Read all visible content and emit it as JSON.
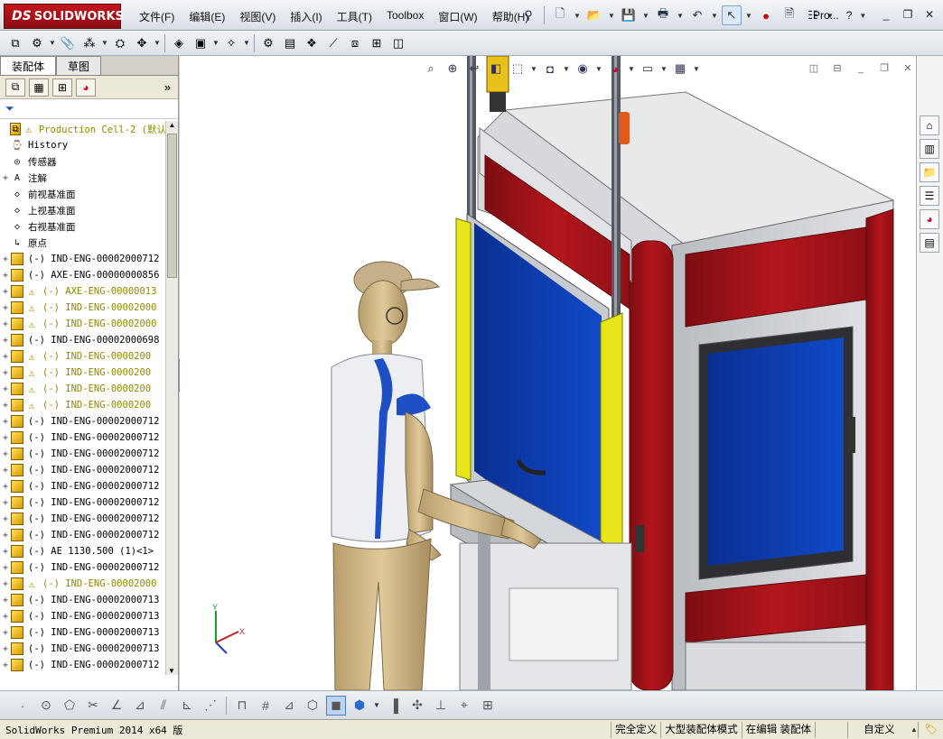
{
  "app": {
    "brand": "SOLIDWORKS",
    "brand_prefix": "DS"
  },
  "menu": [
    "文件(F)",
    "编辑(E)",
    "视图(V)",
    "插入(I)",
    "工具(T)",
    "Toolbox",
    "窗口(W)",
    "帮助(H)"
  ],
  "help_area": {
    "search_label": "Pro..."
  },
  "left_panel": {
    "tabs": [
      "装配体",
      "草图"
    ],
    "tree": [
      {
        "label": "Production Cell-2  (默认",
        "kind": "root",
        "warn": true,
        "yellow": true,
        "expander": ""
      },
      {
        "label": "History",
        "kind": "history",
        "expander": ""
      },
      {
        "label": "传感器",
        "kind": "sensor",
        "expander": ""
      },
      {
        "label": "注解",
        "kind": "annotation",
        "expander": "+"
      },
      {
        "label": "前视基准面",
        "kind": "plane",
        "expander": ""
      },
      {
        "label": "上视基准面",
        "kind": "plane",
        "expander": ""
      },
      {
        "label": "右视基准面",
        "kind": "plane",
        "expander": ""
      },
      {
        "label": "原点",
        "kind": "origin",
        "expander": ""
      },
      {
        "label": "(-) IND-ENG-00002000712",
        "kind": "asm",
        "expander": "+"
      },
      {
        "label": "(-) AXE-ENG-00000000856",
        "kind": "asm",
        "expander": "+"
      },
      {
        "label": "(-) AXE-ENG-00000013",
        "kind": "asm",
        "warn": true,
        "yellow": true,
        "expander": "+"
      },
      {
        "label": "(-) IND-ENG-00002000",
        "kind": "asm",
        "warn": true,
        "yellow": true,
        "expander": "+"
      },
      {
        "label": "(-) IND-ENG-00002000",
        "kind": "asm",
        "warn": true,
        "yellow": true,
        "expander": "+"
      },
      {
        "label": "(-) IND-ENG-00002000698",
        "kind": "asm",
        "expander": "+"
      },
      {
        "label": "(-) IND-ENG-0000200",
        "kind": "asm",
        "warn": true,
        "yellow": true,
        "expander": "+"
      },
      {
        "label": "(-) IND-ENG-0000200",
        "kind": "asm",
        "warn": true,
        "yellow": true,
        "expander": "+"
      },
      {
        "label": "(-) IND-ENG-0000200",
        "kind": "asm",
        "warn": true,
        "yellow": true,
        "expander": "+"
      },
      {
        "label": "(-) IND-ENG-0000200",
        "kind": "asm",
        "warn": true,
        "yellow": true,
        "expander": "+"
      },
      {
        "label": "(-) IND-ENG-00002000712",
        "kind": "asm",
        "expander": "+"
      },
      {
        "label": "(-) IND-ENG-00002000712",
        "kind": "asm",
        "expander": "+"
      },
      {
        "label": "(-) IND-ENG-00002000712",
        "kind": "asm",
        "expander": "+"
      },
      {
        "label": "(-) IND-ENG-00002000712",
        "kind": "asm",
        "expander": "+"
      },
      {
        "label": "(-) IND-ENG-00002000712",
        "kind": "asm",
        "expander": "+"
      },
      {
        "label": "(-) IND-ENG-00002000712",
        "kind": "asm",
        "expander": "+"
      },
      {
        "label": "(-) IND-ENG-00002000712",
        "kind": "asm",
        "expander": "+"
      },
      {
        "label": "(-) IND-ENG-00002000712",
        "kind": "asm",
        "expander": "+"
      },
      {
        "label": "(-) AE 1130.500  (1)<1>",
        "kind": "asm",
        "expander": "+"
      },
      {
        "label": "(-) IND-ENG-00002000712",
        "kind": "asm",
        "expander": "+"
      },
      {
        "label": "(-) IND-ENG-00002000",
        "kind": "asm",
        "warn": true,
        "yellow": true,
        "expander": "+"
      },
      {
        "label": "(-) IND-ENG-00002000713",
        "kind": "asm",
        "expander": "+"
      },
      {
        "label": "(-) IND-ENG-00002000713",
        "kind": "asm",
        "expander": "+"
      },
      {
        "label": "(-) IND-ENG-00002000713",
        "kind": "asm",
        "expander": "+"
      },
      {
        "label": "(-) IND-ENG-00002000713",
        "kind": "asm",
        "expander": "+"
      },
      {
        "label": "(-) IND-ENG-00002000712",
        "kind": "asm",
        "expander": "+"
      },
      {
        "label": "(-) IND-ENG-00002000712",
        "kind": "asm",
        "expander": "+"
      }
    ]
  },
  "status": {
    "main": "SolidWorks Premium 2014 x64 版",
    "fields": [
      "完全定义",
      "大型装配体模式",
      "在编辑 装配体",
      "",
      "自定义"
    ]
  },
  "colors": {
    "cabinet_red": "#a8171c",
    "panel_blue": "#0b3fb5",
    "guard_yellow": "#e7e61a",
    "frame_grey": "#c9ccd0",
    "worker_skin": "#d2b98a",
    "worker_shirt_accent": "#1e4fc7"
  }
}
